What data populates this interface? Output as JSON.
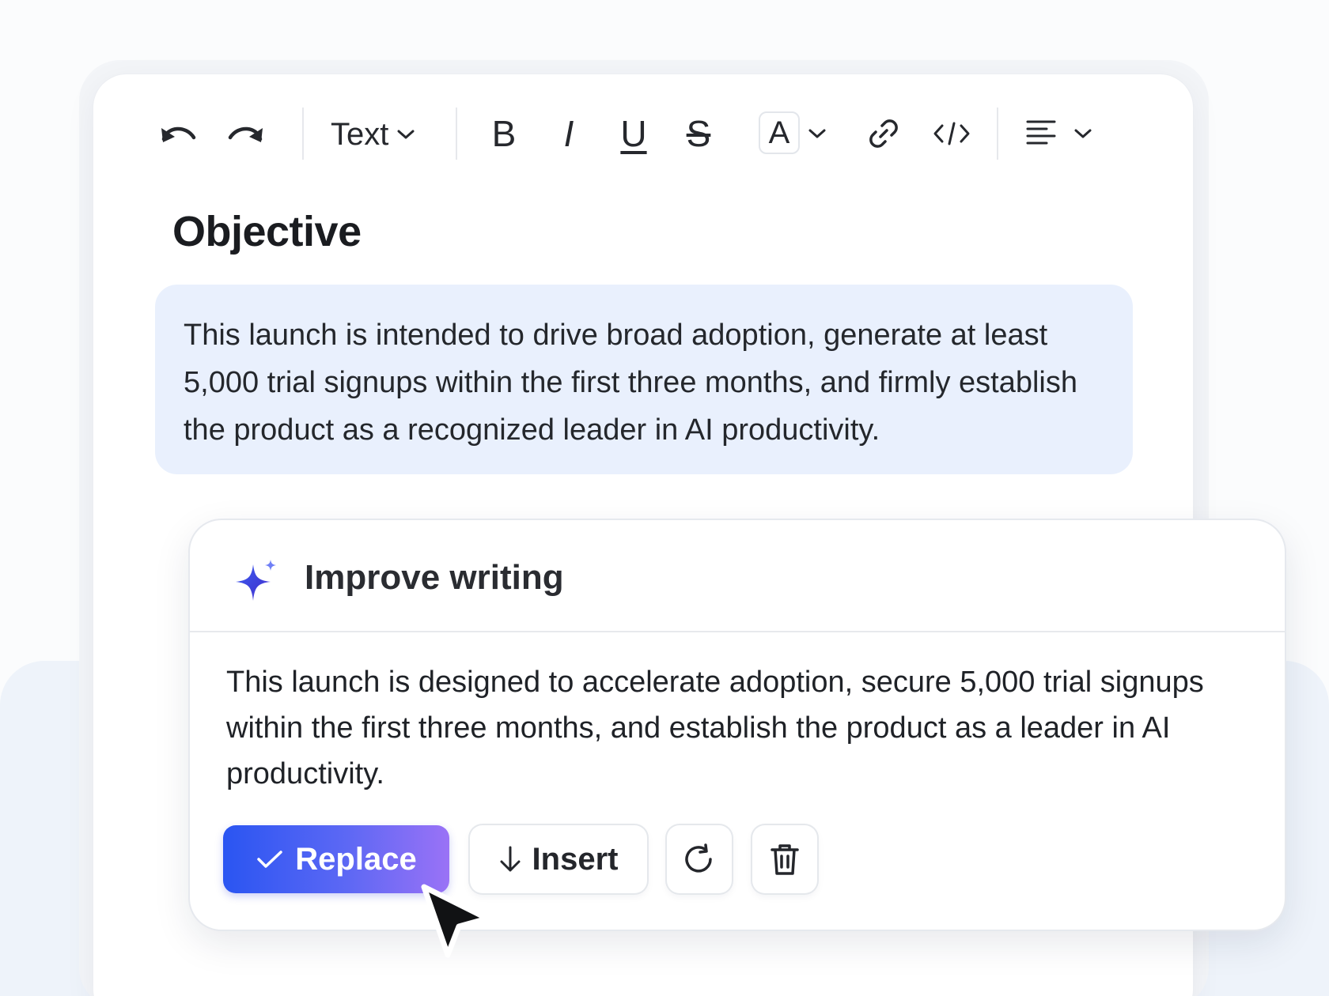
{
  "toolbar": {
    "undo_icon": "undo-icon",
    "redo_icon": "redo-icon",
    "text_style_label": "Text",
    "bold_glyph": "B",
    "italic_glyph": "I",
    "underline_glyph": "U",
    "strikethrough_glyph": "S",
    "font_color_glyph": "A",
    "link_icon": "link-icon",
    "code_icon": "code-icon",
    "align_icon": "align-left-icon"
  },
  "document": {
    "heading": "Objective",
    "selected_paragraph": "This launch is intended to drive broad adoption, generate at least 5,000 trial signups within the first three months, and firmly establish the product as a recognized leader in AI productivity."
  },
  "ai_popup": {
    "icon": "sparkle-icon",
    "title": "Improve writing",
    "suggestion": "This launch is designed to accelerate adoption, secure 5,000 trial signups within the first three months, and establish the product as a leader in AI productivity.",
    "replace_label": "Replace",
    "insert_label": "Insert",
    "retry_icon": "retry-icon",
    "delete_icon": "trash-icon"
  },
  "colors": {
    "accent_start": "#2a55f2",
    "accent_end": "#9a72f6",
    "selection_bg": "#e9f0fd"
  }
}
